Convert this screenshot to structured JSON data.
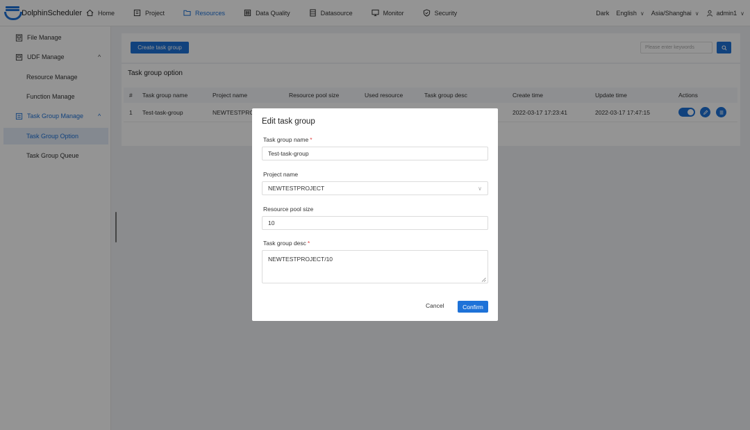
{
  "app": {
    "name": "DolphinScheduler"
  },
  "nav": {
    "items": [
      {
        "label": "Home",
        "icon": "home-icon",
        "active": false
      },
      {
        "label": "Project",
        "icon": "project-icon",
        "active": false
      },
      {
        "label": "Resources",
        "icon": "folder-icon",
        "active": true
      },
      {
        "label": "Data Quality",
        "icon": "data-quality-icon",
        "active": false
      },
      {
        "label": "Datasource",
        "icon": "datasource-icon",
        "active": false
      },
      {
        "label": "Monitor",
        "icon": "monitor-icon",
        "active": false
      },
      {
        "label": "Security",
        "icon": "shield-icon",
        "active": false
      }
    ],
    "theme": "Dark",
    "language": "English",
    "timezone": "Asia/Shanghai",
    "user": "admin1"
  },
  "sidebar": {
    "file_manage": "File Manage",
    "udf_manage": "UDF Manage",
    "resource_manage": "Resource Manage",
    "function_manage": "Function Manage",
    "task_group_manage": "Task Group Manage",
    "task_group_option": "Task Group Option",
    "task_group_queue": "Task Group Queue"
  },
  "toolbar": {
    "create_label": "Create task group",
    "search_placeholder": "Please enter keywords"
  },
  "table": {
    "title": "Task group option",
    "headers": [
      "#",
      "Task group name",
      "Project name",
      "Resource pool size",
      "Used resource",
      "Task group desc",
      "Create time",
      "Update time",
      "Actions"
    ],
    "rows": [
      {
        "index": "1",
        "name": "Test-task-group",
        "project": "NEWTESTPROJECT",
        "create_time": "2022-03-17 17:23:41",
        "update_time": "2022-03-17 17:47:15",
        "enabled": true
      }
    ]
  },
  "modal": {
    "title": "Edit task group",
    "name_label": "Task group name",
    "name_value": "Test-task-group",
    "project_label": "Project name",
    "project_value": "NEWTESTPROJECT",
    "pool_label": "Resource pool size",
    "pool_value": "10",
    "desc_label": "Task group desc",
    "desc_value": "NEWTESTPROJECT/10",
    "required_mark": "*",
    "cancel_label": "Cancel",
    "confirm_label": "Confirm"
  },
  "colors": {
    "accent": "#1e72d8",
    "required": "#e04040",
    "overlay": "rgba(0,0,0,0.42)"
  }
}
